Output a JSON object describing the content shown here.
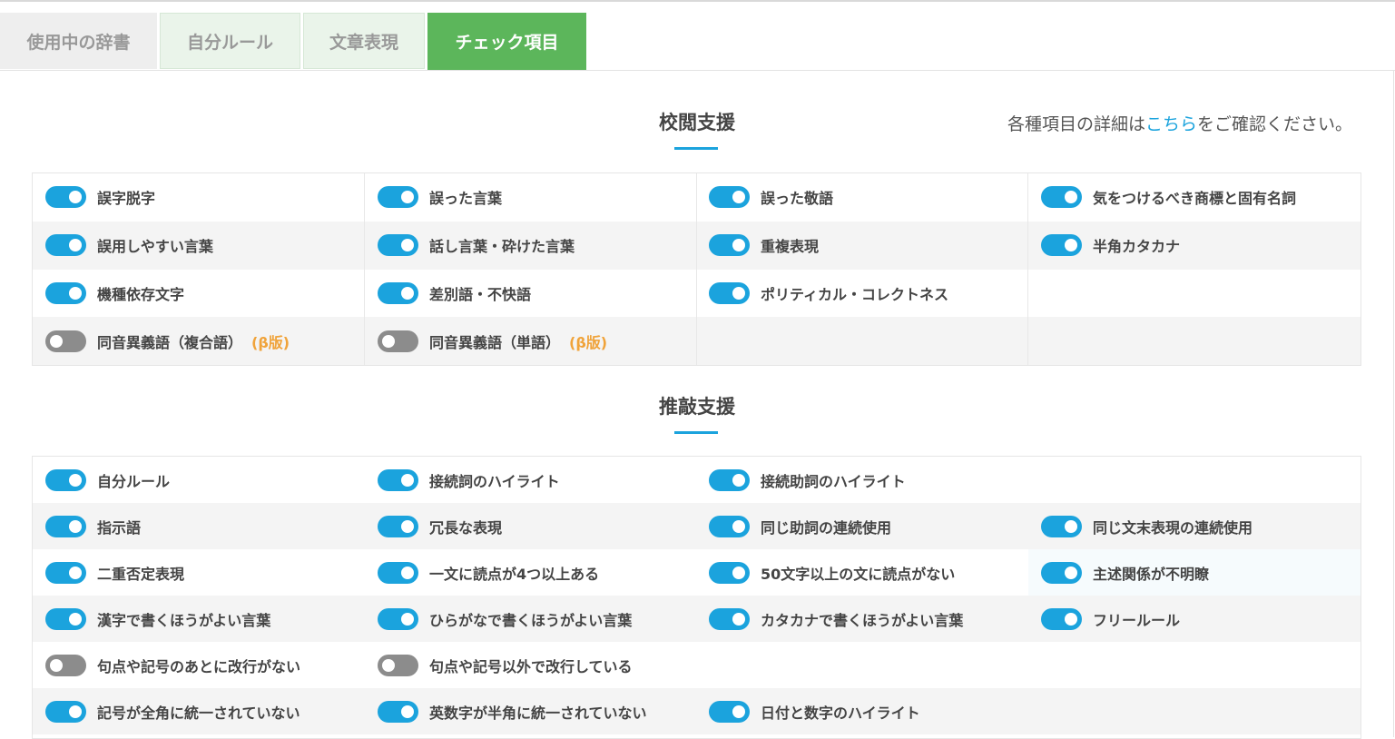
{
  "tabs": [
    {
      "label": "使用中の辞書"
    },
    {
      "label": "自分ルール"
    },
    {
      "label": "文章表現"
    },
    {
      "label": "チェック項目"
    }
  ],
  "colors": {
    "accent": "#1ba3dd",
    "active_tab": "#5cb65b",
    "beta": "#f0a33a",
    "toggle_off": "#8c8c8c"
  },
  "proofreading": {
    "title": "校閲支援",
    "note_before": "各種項目の詳細は",
    "note_link": "こちら",
    "note_after": "をご確認ください。",
    "rows": [
      [
        {
          "label": "誤字脱字",
          "on": true
        },
        {
          "label": "誤った言葉",
          "on": true
        },
        {
          "label": "誤った敬語",
          "on": true
        },
        {
          "label": "気をつけるべき商標と固有名詞",
          "on": true
        }
      ],
      [
        {
          "label": "誤用しやすい言葉",
          "on": true
        },
        {
          "label": "話し言葉・砕けた言葉",
          "on": true
        },
        {
          "label": "重複表現",
          "on": true
        },
        {
          "label": "半角カタカナ",
          "on": true
        }
      ],
      [
        {
          "label": "機種依存文字",
          "on": true
        },
        {
          "label": "差別語・不快語",
          "on": true
        },
        {
          "label": "ポリティカル・コレクトネス",
          "on": true
        }
      ],
      [
        {
          "label": "同音異義語（複合語）",
          "beta": "(β版)",
          "on": false
        },
        {
          "label": "同音異義語（単語）",
          "beta": "(β版)",
          "on": false
        }
      ]
    ]
  },
  "revision": {
    "title": "推敲支援",
    "rows": [
      [
        {
          "label": "自分ルール",
          "on": true
        },
        {
          "label": "接続詞のハイライト",
          "on": true
        },
        {
          "label": "接続助詞のハイライト",
          "on": true
        }
      ],
      [
        {
          "label": "指示語",
          "on": true
        },
        {
          "label": "冗長な表現",
          "on": true
        },
        {
          "label": "同じ助詞の連続使用",
          "on": true
        },
        {
          "label": "同じ文末表現の連続使用",
          "on": true
        }
      ],
      [
        {
          "label": "二重否定表現",
          "on": true
        },
        {
          "label": "一文に読点が4つ以上ある",
          "on": true
        },
        {
          "label": "50文字以上の文に読点がない",
          "on": true
        },
        {
          "label": "主述関係が不明瞭",
          "on": true
        }
      ],
      [
        {
          "label": "漢字で書くほうがよい言葉",
          "on": true
        },
        {
          "label": "ひらがなで書くほうがよい言葉",
          "on": true
        },
        {
          "label": "カタカナで書くほうがよい言葉",
          "on": true
        },
        {
          "label": "フリールール",
          "on": true
        }
      ],
      [
        {
          "label": "句点や記号のあとに改行がない",
          "on": false
        },
        {
          "label": "句点や記号以外で改行している",
          "on": false
        }
      ],
      [
        {
          "label": "記号が全角に統一されていない",
          "on": true
        },
        {
          "label": "英数字が半角に統一されていない",
          "on": true
        },
        {
          "label": "日付と数字のハイライト",
          "on": true
        }
      ]
    ]
  }
}
